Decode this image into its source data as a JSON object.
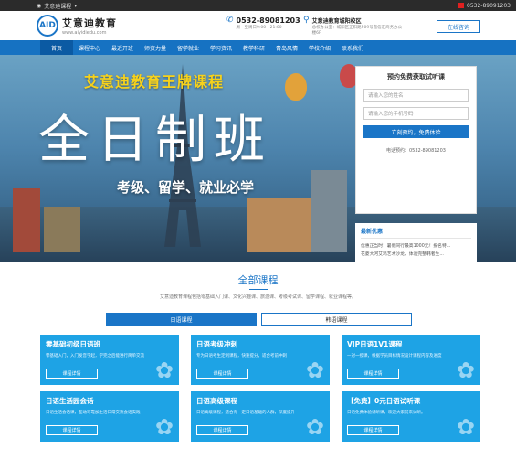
{
  "topbar": {
    "left": "艾意迪课程",
    "right_phone": "0532-89091203"
  },
  "header": {
    "logo_mark": "AID",
    "logo_cn": "艾意迪教育",
    "logo_en": "www.aiyidiedu.com",
    "phone": "0532-89081203",
    "hours": "周一至周日9:00 - 21:00",
    "school_name": "艾意迪教育城阳校区",
    "address": "总校办公室：城阳区正阳路509号嘉信汇商务办公楼6F",
    "consult_button": "在线咨询"
  },
  "nav": [
    "首页",
    "课程中心",
    "最近开班",
    "师资力量",
    "留学就业",
    "学习资讯",
    "教学科研",
    "青岛风情",
    "学校介绍",
    "联系我们"
  ],
  "banner": {
    "headline": "艾意迪教育王牌课程",
    "big": "全日制班",
    "sub": "考级、留学、就业必学"
  },
  "form": {
    "title": "预约免费获取试听课",
    "name_placeholder": "请输入您的姓名",
    "phone_placeholder": "请输入您的手机号码",
    "submit": "立刻预约，免费体验",
    "hotline": "电话预约：0532-89081203"
  },
  "promo": {
    "title": "最新优惠",
    "items": [
      "优惠正当时！暑假同行最高1000元！报名特...",
      "花菱大河艾鸡艺术沙龙，体验完整韩者生..."
    ]
  },
  "courses": {
    "title": "全部课程",
    "desc": "艾意迪教育课程包括零基础入门课、文化兴趣课、旅游课、考级考试课、留学课程、就业课程等。",
    "tabs": [
      "日语课程",
      "韩语课程"
    ],
    "cards": [
      {
        "title": "零基础初级日语班",
        "desc": "零基础入门，入门发音学起，学完之后能进行简单交流",
        "btn": "课程详情"
      },
      {
        "title": "日语考级冲刺",
        "desc": "专为日语考生定制课程，快速提分，适合考前冲刺",
        "btn": "课程详情"
      },
      {
        "title": "VIP日语1V1课程",
        "desc": "一对一授课，根据学员目标情况设计课程内容及进度",
        "btn": "课程详情"
      },
      {
        "title": "日语生活园会话",
        "desc": "日语生活会话课，互动可靠加生活日常交流会话实践",
        "btn": "课程详情"
      },
      {
        "title": "日语高级课程",
        "desc": "日语高级课程，适合有一定日语基础的人群，深度提升",
        "btn": "课程详情"
      },
      {
        "title": "【免费】0元日语试听课",
        "desc": "日语免费体验试听课，欢迎大家前来试听。",
        "btn": "课程详情"
      }
    ]
  }
}
